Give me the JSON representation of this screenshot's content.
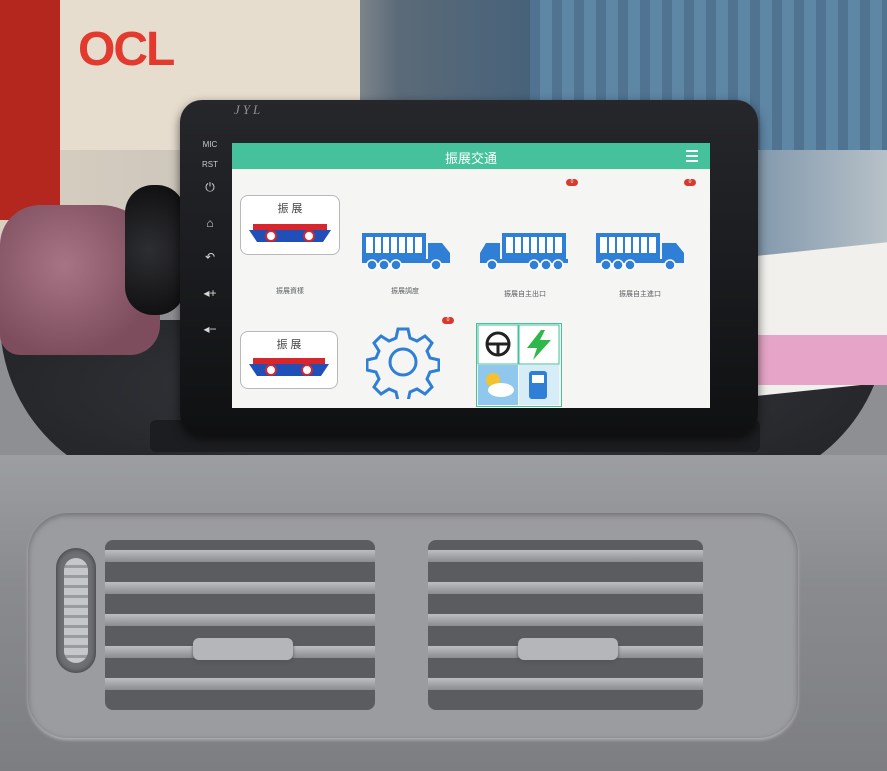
{
  "device": {
    "brand": "JYL",
    "side_buttons": [
      "MIC",
      "RST"
    ]
  },
  "icons": {
    "power": "power-icon",
    "home": "home-icon",
    "back": "back-icon",
    "vol_up": "volume-up-icon",
    "vol_down": "volume-down-icon",
    "menu": "menu-icon",
    "settings": "gear-icon"
  },
  "colors": {
    "appbar": "#45c29c",
    "truck": "#2f7fd6",
    "badge": "#d93a2f",
    "logo_red": "#d7262c"
  },
  "app": {
    "title": "振展交通"
  },
  "tiles": [
    {
      "label": "振展資樣",
      "icon": "zhenzhan-logo"
    },
    {
      "label": "振展調度",
      "icon": "truck-icon"
    },
    {
      "label": "振展自主出口",
      "icon": "truck-icon"
    },
    {
      "label": "振展自主進口",
      "icon": "truck-icon"
    }
  ],
  "row2": [
    {
      "icon": "zhenzhan-logo"
    },
    {
      "icon": "gear-icon"
    },
    {
      "icon": "dashboard-grid-icon"
    }
  ],
  "logo": {
    "text": "振  展"
  },
  "badges": {
    "tile3": "0",
    "tile4": "0",
    "gear": "0"
  }
}
